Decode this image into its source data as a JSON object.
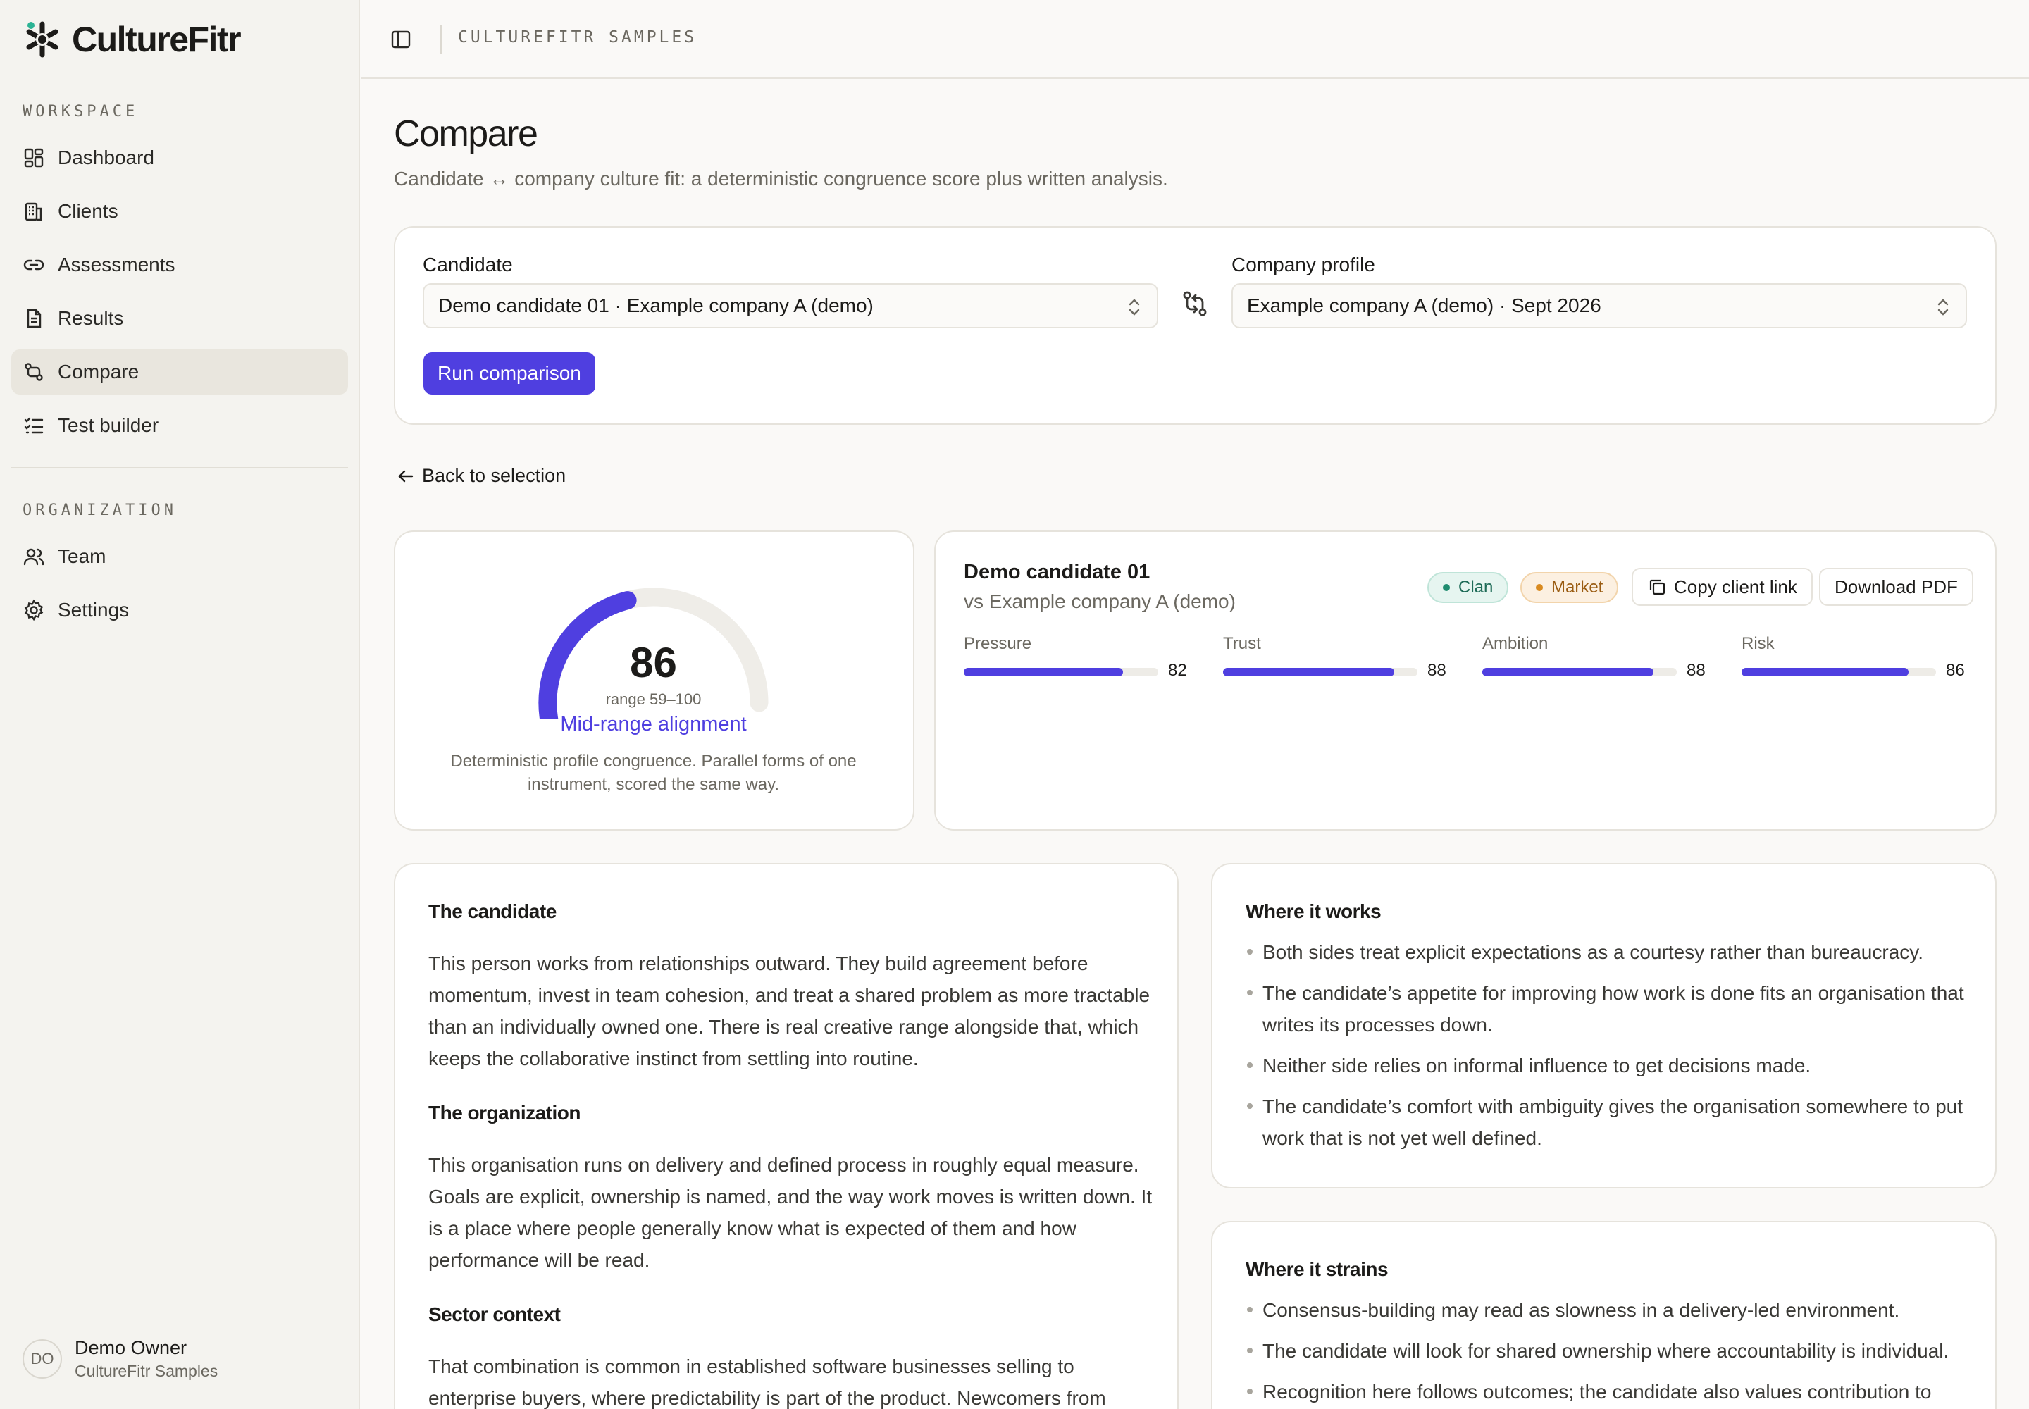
{
  "brand": {
    "name": "CultureFitr",
    "accent": "#2bb394"
  },
  "sidebar": {
    "workspace_label": "WORKSPACE",
    "workspace_items": [
      {
        "label": "Dashboard",
        "icon": "dashboard-icon"
      },
      {
        "label": "Clients",
        "icon": "building-icon"
      },
      {
        "label": "Assessments",
        "icon": "link-icon"
      },
      {
        "label": "Results",
        "icon": "document-icon"
      },
      {
        "label": "Compare",
        "icon": "compare-icon",
        "active": true
      },
      {
        "label": "Test builder",
        "icon": "checklist-icon"
      }
    ],
    "organization_label": "ORGANIZATION",
    "organization_items": [
      {
        "label": "Team",
        "icon": "users-icon"
      },
      {
        "label": "Settings",
        "icon": "gear-icon"
      }
    ],
    "user": {
      "initials": "DO",
      "name": "Demo Owner",
      "org": "CultureFitr Samples"
    }
  },
  "topbar": {
    "breadcrumb": "CULTUREFITR SAMPLES"
  },
  "page": {
    "title": "Compare",
    "subtitle": "Candidate ↔ company culture fit: a deterministic congruence score plus written analysis."
  },
  "selection": {
    "candidate_label": "Candidate",
    "candidate_value": "Demo candidate 01 · Example company A (demo)",
    "company_label": "Company profile",
    "company_value": "Example company A (demo) · Sept 2026",
    "run_label": "Run comparison"
  },
  "back_label": "Back to selection",
  "score": {
    "value": "86",
    "fraction": 0.86,
    "range": "range 59–100",
    "label": "Mid-range alignment",
    "description": "Deterministic profile congruence. Parallel forms of one instrument, scored the same way.",
    "accent": "#4f3fe0"
  },
  "summary": {
    "candidate_name": "Demo candidate 01",
    "versus": "vs Example company A (demo)",
    "tags": [
      "Clan",
      "Market"
    ],
    "copy_link_label": "Copy client link",
    "download_label": "Download PDF",
    "metrics": [
      {
        "label": "Pressure",
        "value": 82
      },
      {
        "label": "Trust",
        "value": 88
      },
      {
        "label": "Ambition",
        "value": 88
      },
      {
        "label": "Risk",
        "value": 86
      }
    ]
  },
  "analysis": {
    "candidate_heading": "The candidate",
    "candidate_text": "This person works from relationships outward. They build agreement before momentum, invest in team cohesion, and treat a shared problem as more tractable than an individually owned one. There is real creative range alongside that, which keeps the collaborative instinct from settling into routine.",
    "organization_heading": "The organization",
    "organization_text": "This organisation runs on delivery and defined process in roughly equal measure. Goals are explicit, ownership is named, and the way work moves is written down. It is a place where people generally know what is expected of them and how performance will be read.",
    "sector_heading": "Sector context",
    "sector_text": "That combination is common in established software businesses selling to enterprise buyers, where predictability is part of the product. Newcomers from looser"
  },
  "works": {
    "heading": "Where it works",
    "items": [
      "Both sides treat explicit expectations as a courtesy rather than bureaucracy.",
      "The candidate’s appetite for improving how work is done fits an organisation that writes its processes down.",
      "Neither side relies on informal influence to get decisions made.",
      "The candidate’s comfort with ambiguity gives the organisation somewhere to put work that is not yet well defined."
    ]
  },
  "strains": {
    "heading": "Where it strains",
    "items": [
      "Consensus-building may read as slowness in a delivery-led environment.",
      "The candidate will look for shared ownership where accountability is individual.",
      "Recognition here follows outcomes; the candidate also values contribution to"
    ]
  }
}
